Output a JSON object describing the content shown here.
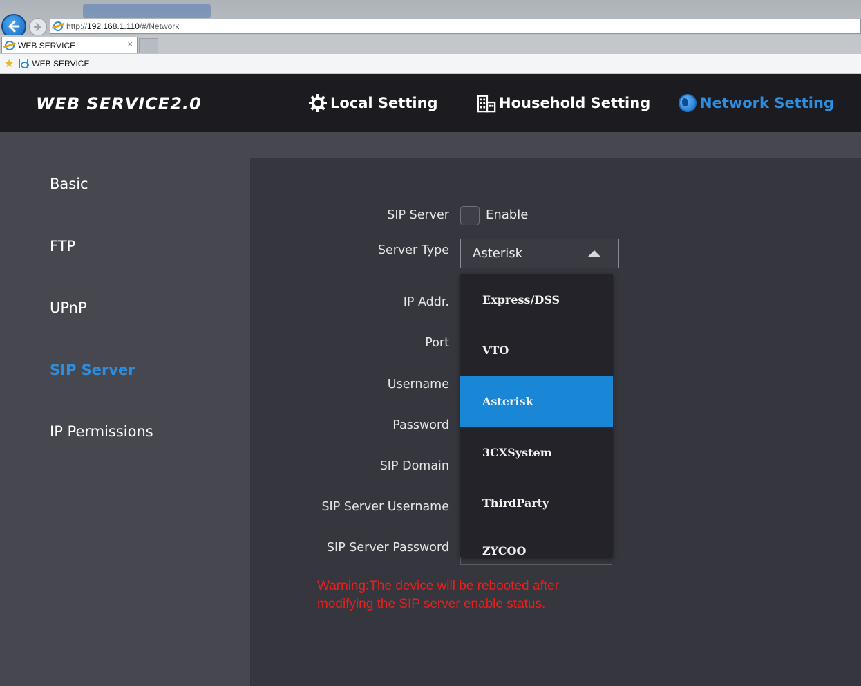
{
  "browser": {
    "url_prefix": "http://",
    "url_host": "192.168.1.110",
    "url_path": "/#/Network",
    "tab_title": "WEB SERVICE",
    "tab_close": "×",
    "favorite_label": "WEB SERVICE"
  },
  "header": {
    "logo": "WEB SERVICE2.0",
    "nav": [
      {
        "label": "Local Setting",
        "icon": "gear-icon"
      },
      {
        "label": "Household Setting",
        "icon": "building-icon"
      },
      {
        "label": "Network Setting",
        "icon": "globe-icon",
        "active": true
      }
    ]
  },
  "sidebar": {
    "items": [
      {
        "label": "Basic"
      },
      {
        "label": "FTP"
      },
      {
        "label": "UPnP"
      },
      {
        "label": "SIP Server",
        "active": true
      },
      {
        "label": "IP Permissions"
      }
    ]
  },
  "form": {
    "labels": {
      "sip_server": "SIP Server",
      "server_type": "Server Type",
      "ip_addr": "IP Addr.",
      "port": "Port",
      "username": "Username",
      "password": "Password",
      "sip_domain": "SIP Domain",
      "sip_server_username": "SIP Server Username",
      "sip_server_password": "SIP Server Password"
    },
    "enable_label": "Enable",
    "enable_checked": false,
    "server_type_value": "Asterisk",
    "server_type_options": [
      "Express/DSS",
      "VTO",
      "Asterisk",
      "3CXSystem",
      "ThirdParty",
      "ZYCOO"
    ],
    "warning": "Warning:The device will be rebooted after modifying the SIP server enable status."
  },
  "colors": {
    "accent": "#2d8ee0",
    "selected_option": "#1a86d6",
    "warning": "#e8201b",
    "header_bg": "#1b1b20"
  }
}
